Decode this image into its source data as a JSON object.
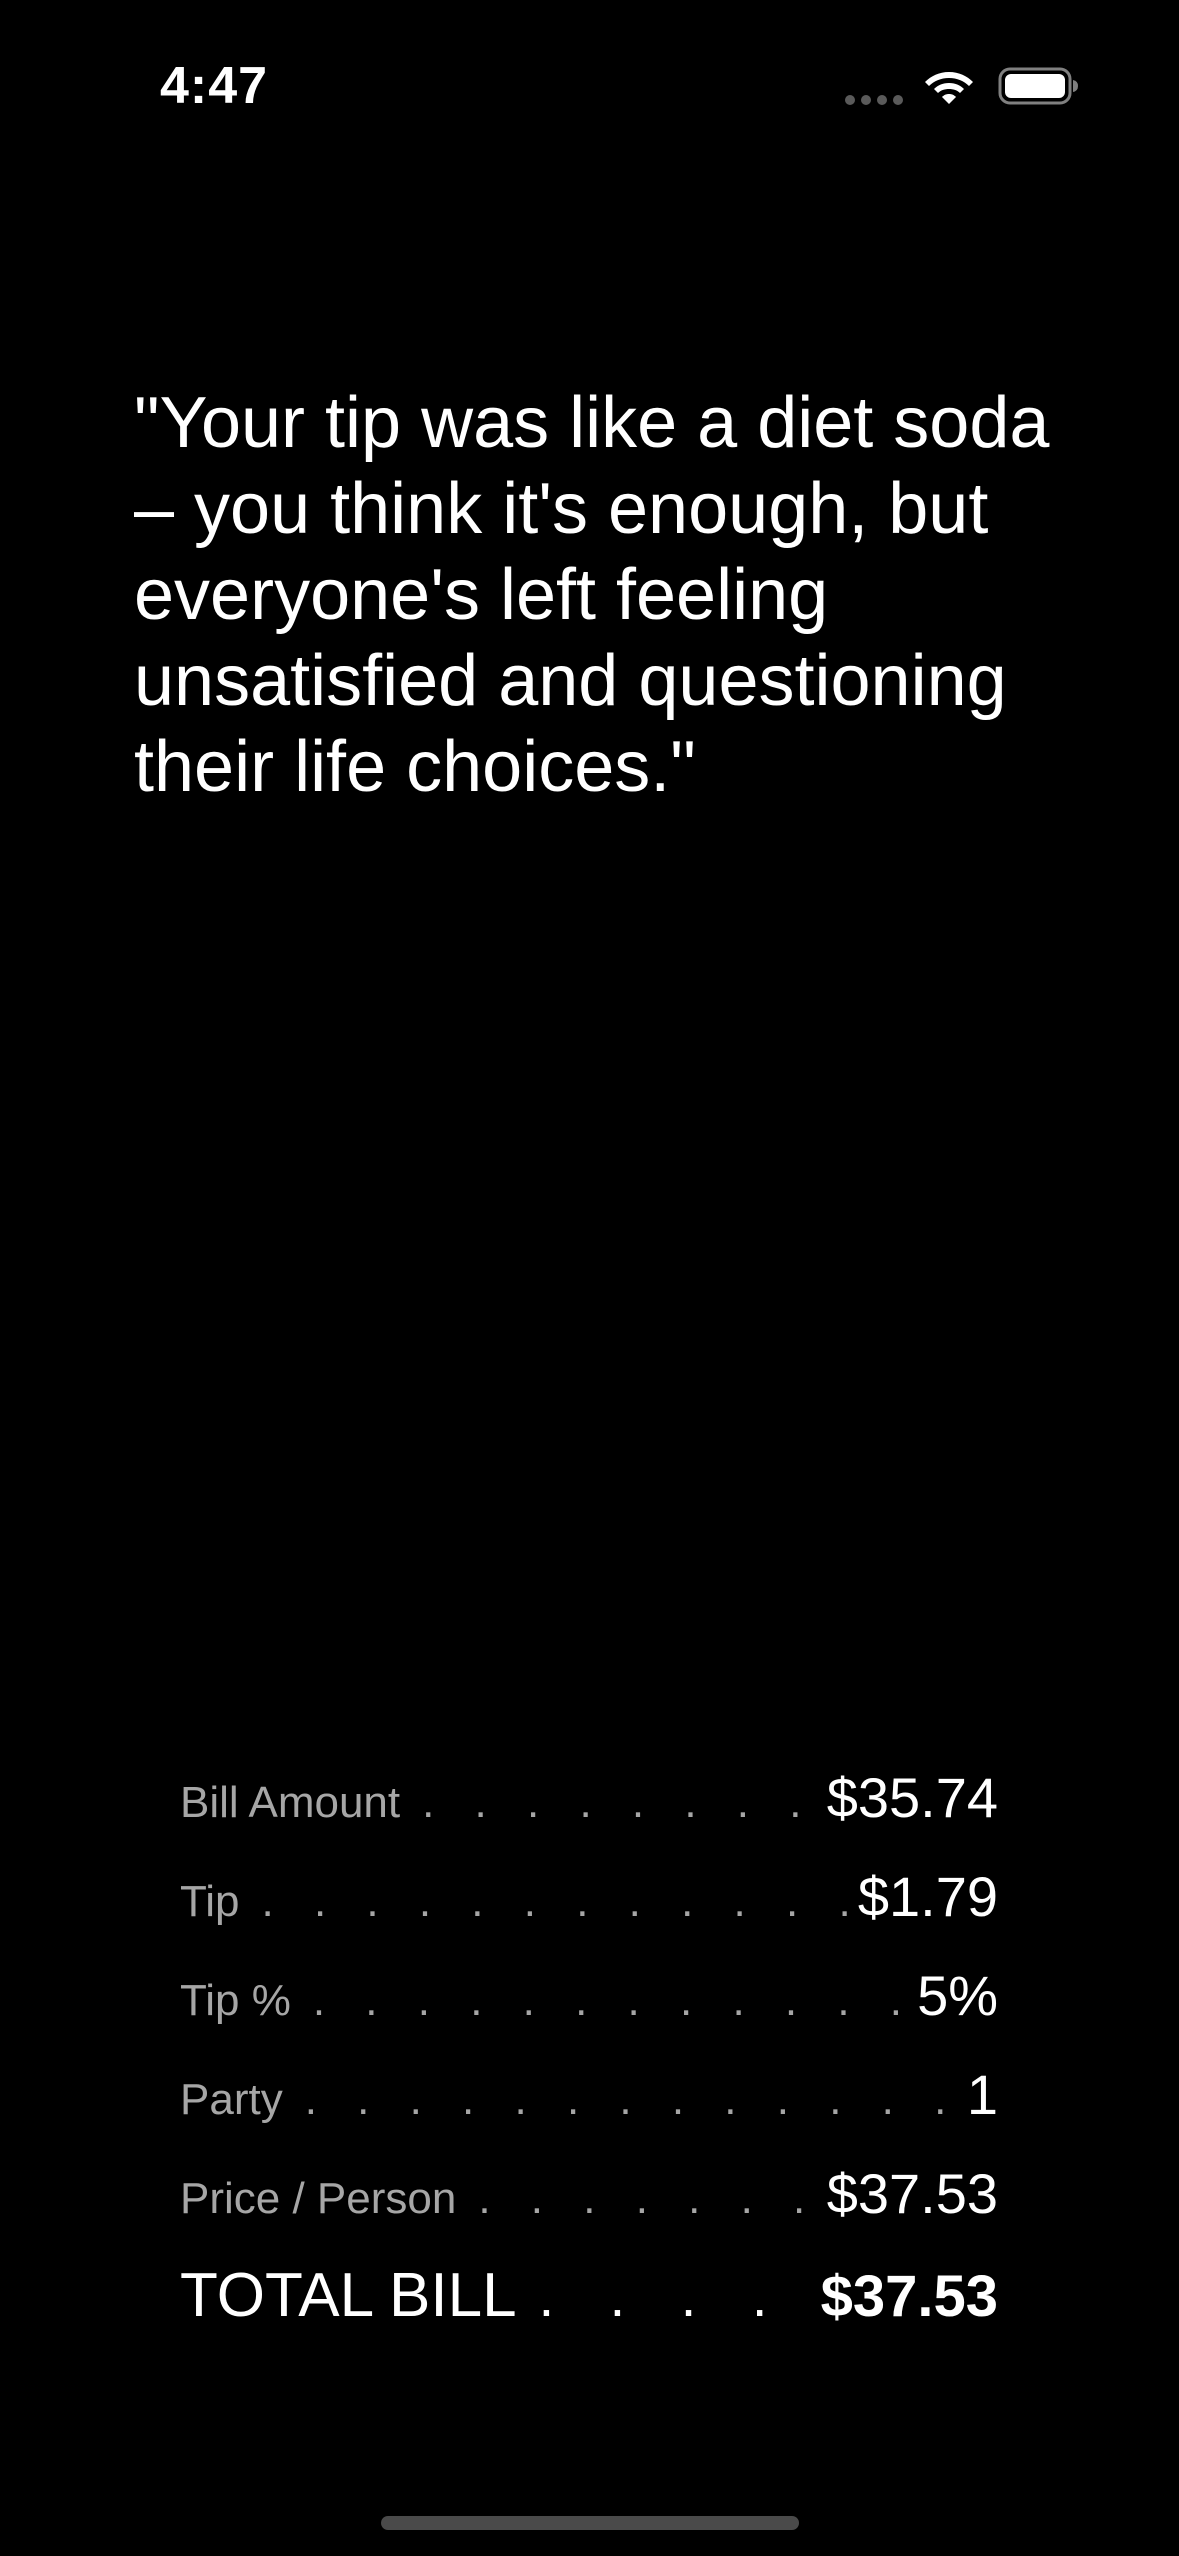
{
  "status_bar": {
    "time": "4:47",
    "icons": [
      "cellular-signal-icon",
      "wifi-icon",
      "battery-icon"
    ]
  },
  "quote": {
    "text": "\"Your tip was like a diet soda – you think it's enough, but everyone's left feeling unsatisfied and questioning their life choices.\""
  },
  "summary": {
    "rows": [
      {
        "label": "Bill Amount",
        "value": "$35.74"
      },
      {
        "label": "Tip",
        "value": "$1.79"
      },
      {
        "label": "Tip %",
        "value": "5%"
      },
      {
        "label": "Party",
        "value": "1"
      },
      {
        "label": "Price / Person",
        "value": "$37.53"
      }
    ],
    "total": {
      "label": "TOTAL BILL",
      "value": "$37.53"
    }
  },
  "colors": {
    "background": "#000000",
    "text": "#ffffff",
    "muted_text": "#a6a6a6"
  }
}
